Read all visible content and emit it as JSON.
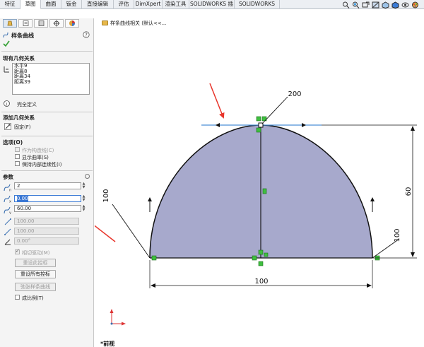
{
  "tabs": [
    {
      "label": "特征",
      "active": false
    },
    {
      "label": "草图",
      "active": true
    },
    {
      "label": "曲面",
      "active": false
    },
    {
      "label": "钣金",
      "active": false
    },
    {
      "label": "直接编辑",
      "active": false
    },
    {
      "label": "评估",
      "active": false
    },
    {
      "label": "DimXpert",
      "active": false
    },
    {
      "label": "渲染工具",
      "active": false
    },
    {
      "label": "SOLIDWORKS 插件",
      "active": false
    },
    {
      "label": "SOLIDWORKS MBD",
      "active": false
    }
  ],
  "breadcrumb": {
    "text": "样条曲线相关 (默认<<..."
  },
  "panel": {
    "title": "样条曲线",
    "relations": {
      "title": "现有几何关系",
      "items": [
        "水平9",
        "距离8",
        "距离34",
        "距离39"
      ],
      "status": "完全定义"
    },
    "add_relations": {
      "title": "添加几何关系",
      "fix_label": "固定(F)"
    },
    "options": {
      "title": "选项(O)",
      "construction": "作为构造线(C)",
      "show_curvature": "显示曲率(S)",
      "keep_continuity": "保持内部连续性(I)"
    },
    "params": {
      "title": "参数",
      "field1": "2",
      "field2": "0.00",
      "field3": "60.00",
      "field4": "100.00",
      "field5": "100.00",
      "field6": "0.00°",
      "tangent_driving": "相切驱动(M)",
      "reset_handle": "重设此控标",
      "reset_all": "重设所有控标",
      "relax_spline": "弛张样条曲线",
      "proportional": "成比例(T)"
    }
  },
  "drawing": {
    "dim_200": "200",
    "dim_100_left": "100",
    "dim_100_right": "100",
    "dim_100_bottom": "100",
    "dim_60": "60",
    "view_label": "*前视",
    "fill_color": "#a7a9cc",
    "arrow_color": "#e8352b"
  }
}
